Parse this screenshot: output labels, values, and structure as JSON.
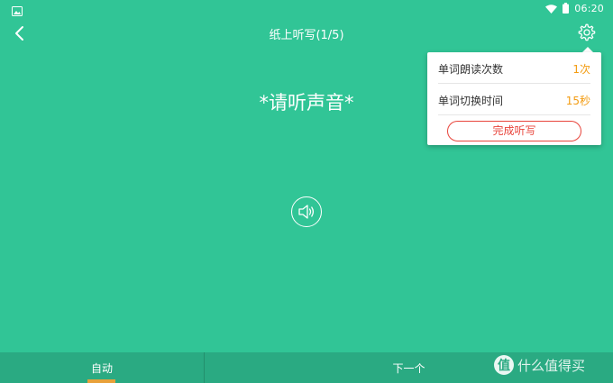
{
  "status_bar": {
    "time": "06:20"
  },
  "header": {
    "title": "纸上听写(1/5)"
  },
  "main": {
    "prompt": "*请听声音*"
  },
  "settings_menu": {
    "items": [
      {
        "label": "单词朗读次数",
        "value": "1次"
      },
      {
        "label": "单词切换时间",
        "value": "15秒"
      }
    ],
    "finish_label": "完成听写"
  },
  "bottom_bar": {
    "auto_label": "自动",
    "next_label": "下一个"
  },
  "watermark": {
    "logo": "值",
    "text": "什么值得买"
  },
  "colors": {
    "background": "#31c596",
    "bottom_bar": "#2aaa82",
    "accent_orange": "#f39c12",
    "accent_red": "#e8453c"
  }
}
